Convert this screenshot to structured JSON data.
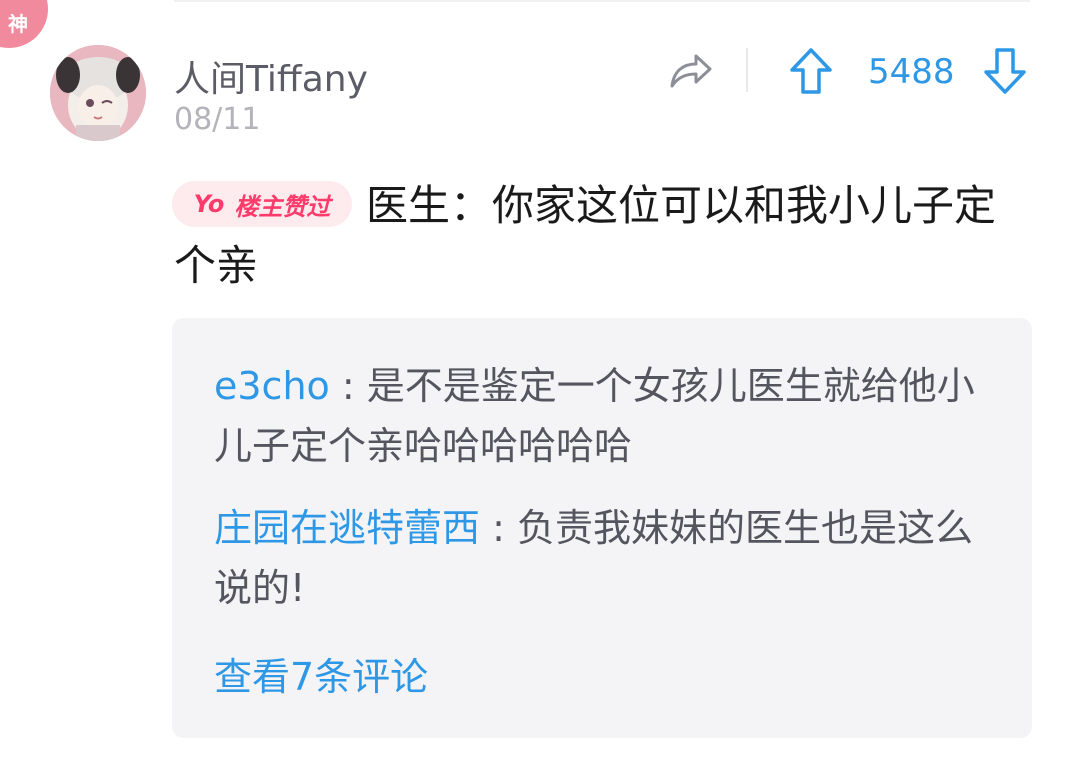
{
  "badge_god": "神",
  "post": {
    "username": "人间Tiffany",
    "date": "08/11",
    "vote_count": "5488",
    "owner_badge": {
      "yo": "Yo",
      "text": "楼主赞过"
    },
    "content": "医生：你家这位可以和我小儿子定个亲"
  },
  "replies": [
    {
      "author": "e3cho",
      "separator": " : ",
      "text": "是不是鉴定一个女孩儿医生就给他小儿子定个亲哈哈哈哈哈哈"
    },
    {
      "author": "庄园在逃特蕾西",
      "separator": " : ",
      "text": "负责我妹妹的医生也是这么说的!"
    }
  ],
  "view_more": "查看7条评论",
  "colors": {
    "accent": "#2e98e6",
    "badge_pink": "#ff3b6c",
    "god_badge": "#f08a9c"
  },
  "icons": [
    "share-icon",
    "arrow-up-icon",
    "arrow-down-icon"
  ]
}
